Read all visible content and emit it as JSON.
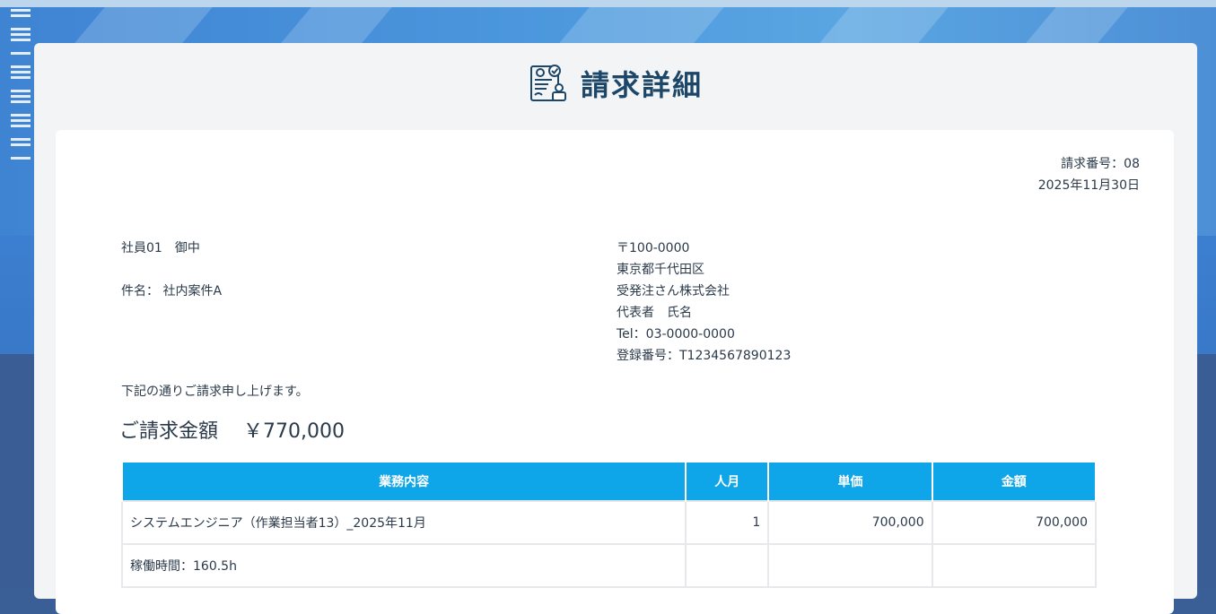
{
  "page": {
    "title": "請求詳細",
    "title_icon": "invoice-document-icon"
  },
  "invoice": {
    "number": "請求番号：08",
    "date": "2025年11月30日",
    "recipient": "社員01　御中",
    "subject": "件名： 社内案件A",
    "issuer": {
      "postal": "〒100-0000",
      "address": "東京都千代田区",
      "company": "受発注さん株式会社",
      "representative": "代表者　氏名",
      "tel": "Tel：03-0000-0000",
      "registration": "登録番号：T1234567890123"
    },
    "notice": "下記の通りご請求申し上げます。",
    "amount_label": "ご請求金額",
    "amount_value": "￥770,000"
  },
  "table": {
    "headers": [
      "業務内容",
      "人月",
      "単価",
      "金額"
    ],
    "rows": [
      {
        "description": "システムエンジニア（作業担当者13）_2025年11月",
        "qty": "1",
        "unit_price": "700,000",
        "amount": "700,000"
      },
      {
        "description": "稼働時間：160.5h",
        "qty": "",
        "unit_price": "",
        "amount": ""
      }
    ]
  },
  "colors": {
    "header_bg": "#0ea5e9",
    "title_color": "#1d4768"
  }
}
